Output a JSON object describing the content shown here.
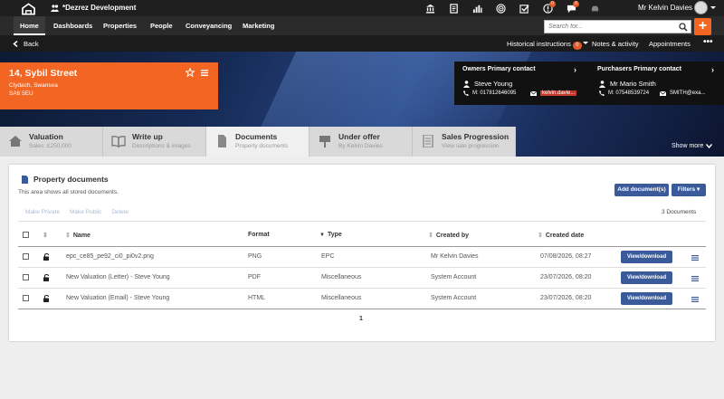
{
  "topbar": {
    "brand": "*Dezrez Development",
    "user_name": "Mr Kelvin Davies",
    "icons": [
      "bank-icon",
      "report-icon",
      "chart-icon",
      "target-icon",
      "tasks-icon",
      "alert-icon",
      "chat-icon",
      "car-icon"
    ],
    "badges": {
      "alert": "0",
      "chat": "0"
    }
  },
  "nav": {
    "items": [
      "Home",
      "Dashboards",
      "Properties",
      "People",
      "Conveyancing",
      "Marketing"
    ],
    "search_placeholder": "Search for..."
  },
  "subbar": {
    "back": "Back",
    "historical": "Historical instructions",
    "historical_count": "0",
    "notes": "Notes & activity",
    "appointments": "Appointments"
  },
  "property": {
    "address": "14, Sybil Street",
    "area": "Clydach, Swansea",
    "postcode": "SA6 5EU"
  },
  "owners": {
    "title": "Owners Primary contact",
    "name": "Steve Young",
    "mobile": "M: 017812646095",
    "email": "kelvin.davie..."
  },
  "purchasers": {
    "title": "Purchasers Primary contact",
    "name": "Mr Mario Smith",
    "mobile": "M: 07548539724",
    "email": "SMITH@exa..."
  },
  "tabs": [
    {
      "title": "Valuation",
      "sub": "Sales: £250,000"
    },
    {
      "title": "Write up",
      "sub": "Descriptions & images"
    },
    {
      "title": "Documents",
      "sub": "Property documents"
    },
    {
      "title": "Under offer",
      "sub": "By Kelvin Davies"
    },
    {
      "title": "Sales Progression",
      "sub": "View sale progression"
    }
  ],
  "show_more": "Show more",
  "panel": {
    "title": "Property documents",
    "desc": "This area shows all stored documents.",
    "add": "Add document(s)",
    "filters": "Filters",
    "actions": [
      "Make Private",
      "Make Public",
      "Delete"
    ],
    "count": "3 Documents",
    "columns": [
      "Name",
      "Format",
      "Type",
      "Created by",
      "Created date"
    ],
    "rows": [
      {
        "name": "epc_ce85_pe92_ci0_pi0v2.png",
        "format": "PNG",
        "type": "EPC",
        "created_by": "Mr Kelvin Davies",
        "date": "07/08/2026, 08:27",
        "button": "View/download"
      },
      {
        "name": "New Valuation (Letter) - Steve Young",
        "format": "PDF",
        "type": "Miscellaneous",
        "created_by": "System Account",
        "date": "23/07/2026, 08:20",
        "button": "View/download"
      },
      {
        "name": "New Valuation (Email) - Steve Young",
        "format": "HTML",
        "type": "Miscellaneous",
        "created_by": "System Account",
        "date": "23/07/2026, 08:20",
        "button": "View/download"
      }
    ],
    "page": "1"
  },
  "colors": {
    "accent": "#f26522",
    "button": "#3a5a9a",
    "badge": "#e05a2b"
  }
}
